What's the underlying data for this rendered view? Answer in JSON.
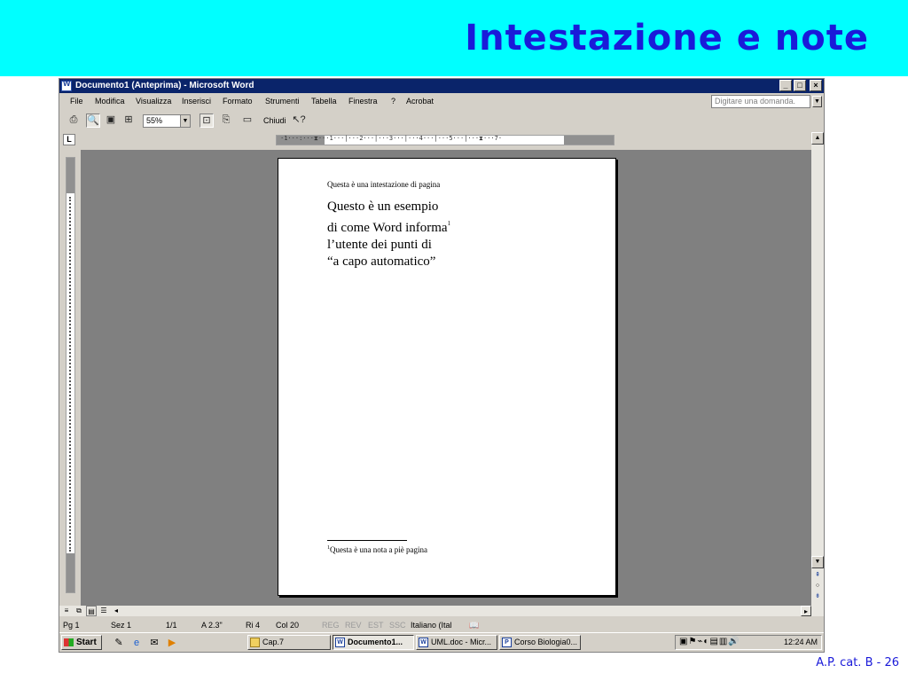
{
  "slide": {
    "title": "Intestazione e note",
    "footer": "A.P. cat. B - 26"
  },
  "window": {
    "title": "Documento1 (Anteprima) - Microsoft Word",
    "controls": [
      "_",
      "□",
      "×"
    ]
  },
  "menubar": {
    "items": [
      "File",
      "Modifica",
      "Visualizza",
      "Inserisci",
      "Formato",
      "Strumenti",
      "Tabella",
      "Finestra",
      "?",
      "Acrobat"
    ],
    "ask_placeholder": "Digitare una domanda."
  },
  "toolbar": {
    "zoom": "55%",
    "close_label": "Chiudi"
  },
  "document": {
    "header_text": "Questa è una intestazione di pagina",
    "body_lines": [
      "Questo è un esempio",
      "di come Word informa",
      "l’utente dei punti di",
      "“a capo automatico”"
    ],
    "footnote_mark": "1",
    "footnote_text": "Questa è una nota a piè pagina"
  },
  "statusbar": {
    "page": "Pg 1",
    "section": "Sez 1",
    "pages": "1/1",
    "at": "A 2.3\"",
    "line": "Ri 4",
    "col": "Col 20",
    "rec": "REG",
    "trk": "REV",
    "ext": "EST",
    "ovr": "SSC",
    "language": "Italiano (Ital"
  },
  "taskbar": {
    "start_label": "Start",
    "tasks": [
      "Cap.7",
      "Documento1...",
      "UML.doc - Micr...",
      "Corso Biologia0..."
    ],
    "clock": "12:24 AM"
  }
}
